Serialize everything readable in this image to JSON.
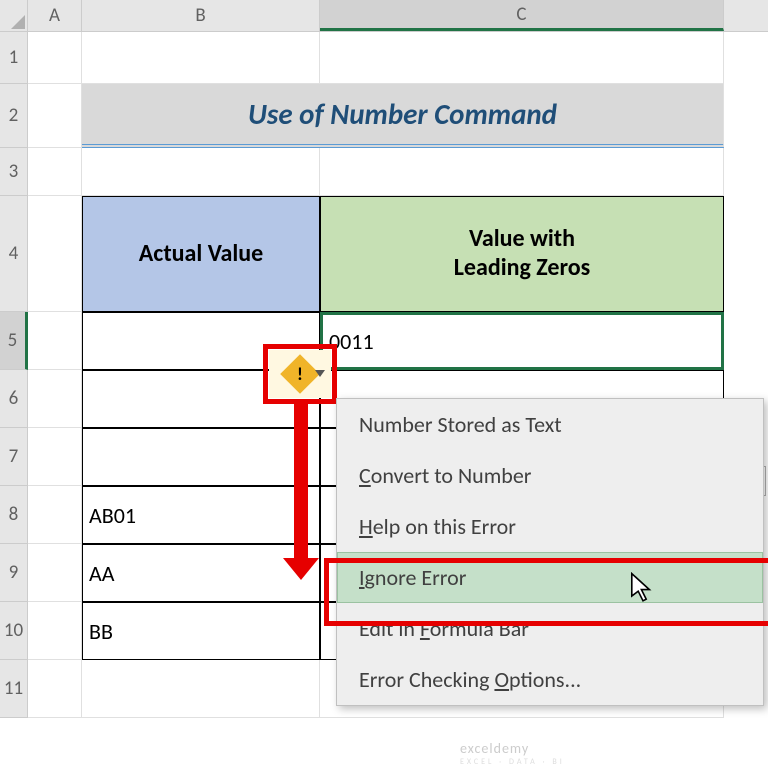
{
  "columns": {
    "A": "A",
    "B": "B",
    "C": "C"
  },
  "rows": [
    "1",
    "2",
    "3",
    "4",
    "5",
    "6",
    "7",
    "8",
    "9",
    "10",
    "11"
  ],
  "title": "Use of Number Command",
  "headers": {
    "b": "Actual Value",
    "c_line1": "Value with",
    "c_line2": "Leading Zeros"
  },
  "cells": {
    "b5": "",
    "c5": "0011",
    "b6": "",
    "b7": "",
    "b8": "AB01",
    "b9": "AA",
    "b10": "BB"
  },
  "error_tag": {
    "symbol": "!"
  },
  "menu": {
    "item1": "Number Stored as Text",
    "item2_pre": "C",
    "item2_rest": "onvert to Number",
    "item3_pre": "H",
    "item3_rest": "elp on this Error",
    "item4_pre": "I",
    "item4_rest": "gnore Error",
    "item5a": "Edit in ",
    "item5_u": "F",
    "item5b": "ormula Bar",
    "item6a": "Error Checking ",
    "item6_u": "O",
    "item6b": "ptions..."
  },
  "watermark": {
    "brand": "exceldemy",
    "tag": "EXCEL · DATA · BI"
  }
}
